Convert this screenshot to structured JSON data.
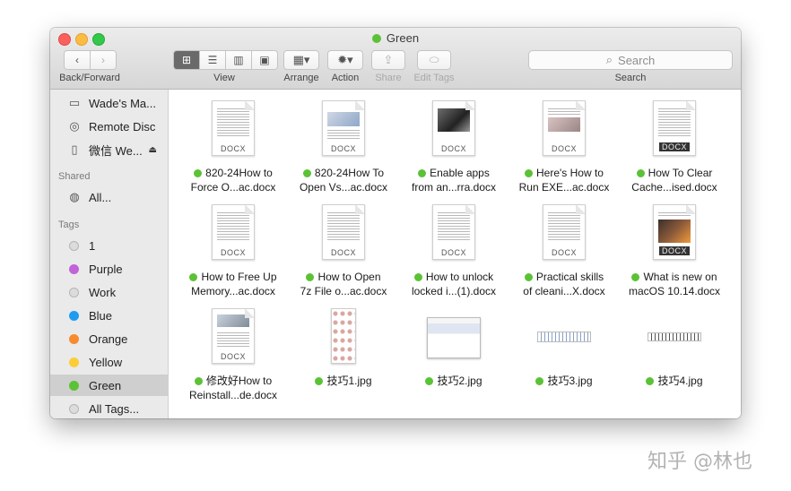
{
  "window": {
    "title": "Green",
    "title_tag_color": "#5bc236"
  },
  "toolbar": {
    "nav_label": "Back/Forward",
    "view_label": "View",
    "arrange_label": "Arrange",
    "action_label": "Action",
    "share_label": "Share",
    "edit_tags_label": "Edit Tags",
    "search_label": "Search",
    "search_placeholder": "Search"
  },
  "sidebar": {
    "devices": [
      {
        "label": "Wade's Ma...",
        "icon": "laptop-icon"
      },
      {
        "label": "Remote Disc",
        "icon": "disc-icon"
      },
      {
        "label": "微信 We...",
        "icon": "drive-icon"
      }
    ],
    "shared_header": "Shared",
    "shared": [
      {
        "label": "All...",
        "icon": "network-icon"
      }
    ],
    "tags_header": "Tags",
    "tags": [
      {
        "label": "1",
        "color": "#d9d9d9"
      },
      {
        "label": "Purple",
        "color": "#c064d8"
      },
      {
        "label": "Work",
        "color": "#d9d9d9"
      },
      {
        "label": "Blue",
        "color": "#1e9cf0"
      },
      {
        "label": "Orange",
        "color": "#f78b2f"
      },
      {
        "label": "Yellow",
        "color": "#fbcd39"
      },
      {
        "label": "Green",
        "color": "#5bc236"
      },
      {
        "label": "All Tags...",
        "color": "#d0d0d0"
      }
    ]
  },
  "files": [
    {
      "line1": "820-24How to",
      "line2": "Force O...ac.docx",
      "kind": "docx"
    },
    {
      "line1": "820-24How To",
      "line2": "Open Vs...ac.docx",
      "kind": "docx"
    },
    {
      "line1": "Enable apps",
      "line2": "from an...rra.docx",
      "kind": "docx"
    },
    {
      "line1": "Here's How to",
      "line2": "Run EXE...ac.docx",
      "kind": "docx"
    },
    {
      "line1": "How To Clear",
      "line2": "Cache...ised.docx",
      "kind": "docx"
    },
    {
      "line1": "How to Free Up",
      "line2": "Memory...ac.docx",
      "kind": "docx"
    },
    {
      "line1": "How to Open",
      "line2": "7z File o...ac.docx",
      "kind": "docx"
    },
    {
      "line1": "How to unlock",
      "line2": "locked i...(1).docx",
      "kind": "docx"
    },
    {
      "line1": "Practical skills",
      "line2": "of cleani...X.docx",
      "kind": "docx"
    },
    {
      "line1": "What is new on",
      "line2": "macOS 10.14.docx",
      "kind": "docx"
    },
    {
      "line1": "修改好How to",
      "line2": "Reinstall...de.docx",
      "kind": "docx"
    },
    {
      "line1": "技巧1.jpg",
      "line2": "",
      "kind": "jpg"
    },
    {
      "line1": "技巧2.jpg",
      "line2": "",
      "kind": "jpg"
    },
    {
      "line1": "技巧3.jpg",
      "line2": "",
      "kind": "jpg"
    },
    {
      "line1": "技巧4.jpg",
      "line2": "",
      "kind": "jpg"
    }
  ],
  "doc_ext_label": "DOCX",
  "watermark": "知乎 @林也"
}
